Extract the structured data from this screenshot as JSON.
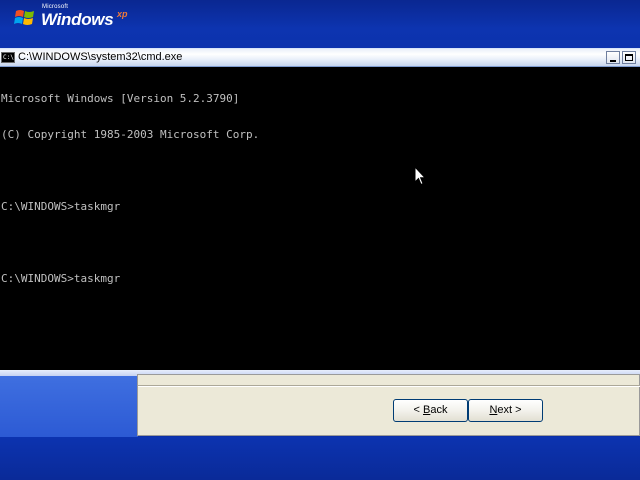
{
  "branding": {
    "small": "Microsoft",
    "product": "Windows",
    "edition": "xp"
  },
  "console": {
    "title": "C:\\WINDOWS\\system32\\cmd.exe",
    "icon_text": "C:\\",
    "lines": [
      "Microsoft Windows [Version 5.2.3790]",
      "(C) Copyright 1985-2003 Microsoft Corp.",
      "",
      "C:\\WINDOWS>taskmgr",
      "",
      "C:\\WINDOWS>taskmgr"
    ]
  },
  "wizard": {
    "back_prefix": "< ",
    "back_hotkey": "B",
    "back_rest": "ack",
    "next_hotkey": "N",
    "next_rest": "ext >"
  },
  "icons": {
    "logo": "windows-flag-icon",
    "console": "console-icon",
    "minimize": "minimize-icon",
    "maximize": "maximize-icon",
    "cursor": "mouse-pointer-icon"
  },
  "colors": {
    "desktop": "#0b30a8",
    "console_bg": "#000000",
    "console_text": "#c0c0c0",
    "wizard_bg": "#ece9d8"
  }
}
